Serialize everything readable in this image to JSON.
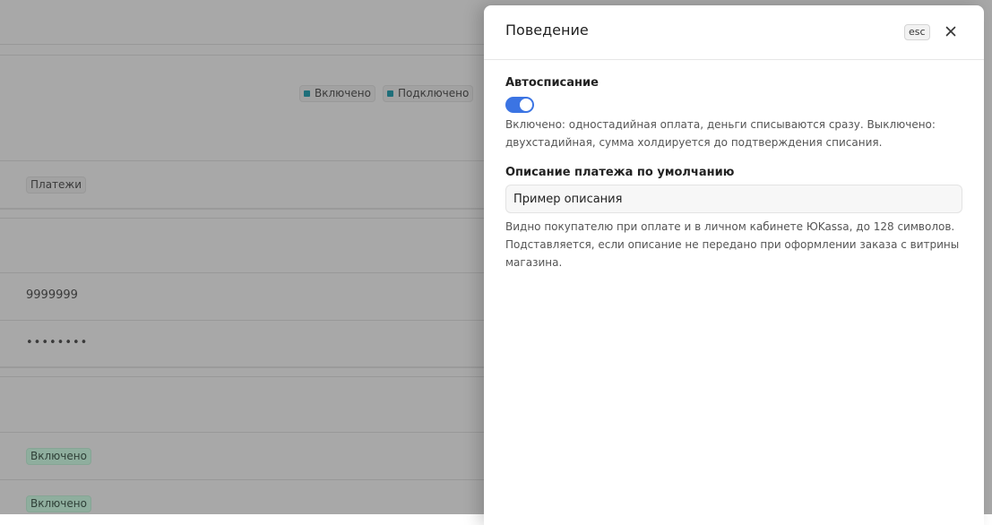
{
  "background": {
    "badges_top": [
      {
        "label": "Включено"
      },
      {
        "label": "Подключено"
      }
    ],
    "payments_badge": "Платежи",
    "shop_id_value": "9999999",
    "secret_value": "••••••••",
    "status_badges": [
      {
        "label": "Включено"
      },
      {
        "label": "Включено"
      }
    ]
  },
  "panel": {
    "title": "Поведение",
    "esc_label": "esc",
    "close_icon": "close-icon",
    "autopay": {
      "label": "Автосписание",
      "enabled": true,
      "hint": "Включено: одностадийная оплата, деньги списываются сразу. Выключено: двухстадийная, сумма холдируется до подтверждения списания."
    },
    "description": {
      "label": "Описание платежа по умолчанию",
      "value": "Пример описания",
      "placeholder": "",
      "hint": "Видно покупателю при оплате и в личном кабинете ЮKassa, до 128 символов. Подставляется, если описание не передано при оформлении заказа с витрины магазина."
    }
  },
  "colors": {
    "toggle_on": "#3b74e3",
    "status_dot": "#1f6f7a",
    "overlay": "#a8a8a8"
  }
}
